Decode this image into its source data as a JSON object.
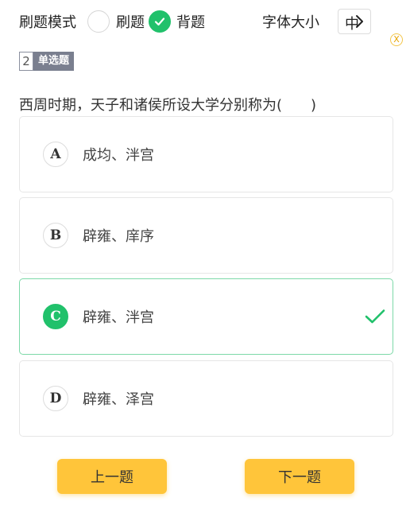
{
  "header": {
    "mode_label": "刷题模式",
    "modes": [
      {
        "label": "刷题",
        "checked": false
      },
      {
        "label": "背题",
        "checked": true
      }
    ],
    "font_size_label": "字体大小",
    "font_size_value": "中",
    "close_label": "X"
  },
  "question": {
    "number": "2",
    "type": "单选题",
    "text": "西周时期，天子和诸侯所设大学分别称为(　　)"
  },
  "options": [
    {
      "letter": "A",
      "text": "成均、泮宫",
      "selected": false
    },
    {
      "letter": "B",
      "text": "辟雍、庠序",
      "selected": false
    },
    {
      "letter": "C",
      "text": "辟雍、泮宫",
      "selected": true
    },
    {
      "letter": "D",
      "text": "辟雍、泽宫",
      "selected": false
    }
  ],
  "nav": {
    "prev_label": "上一题",
    "next_label": "下一题"
  },
  "colors": {
    "accent_green": "#21c16b",
    "button_yellow": "#ffc53a",
    "badge_gray": "#7a7f8f"
  },
  "icons": [
    "chevron-right-icon",
    "check-icon",
    "close-icon"
  ]
}
